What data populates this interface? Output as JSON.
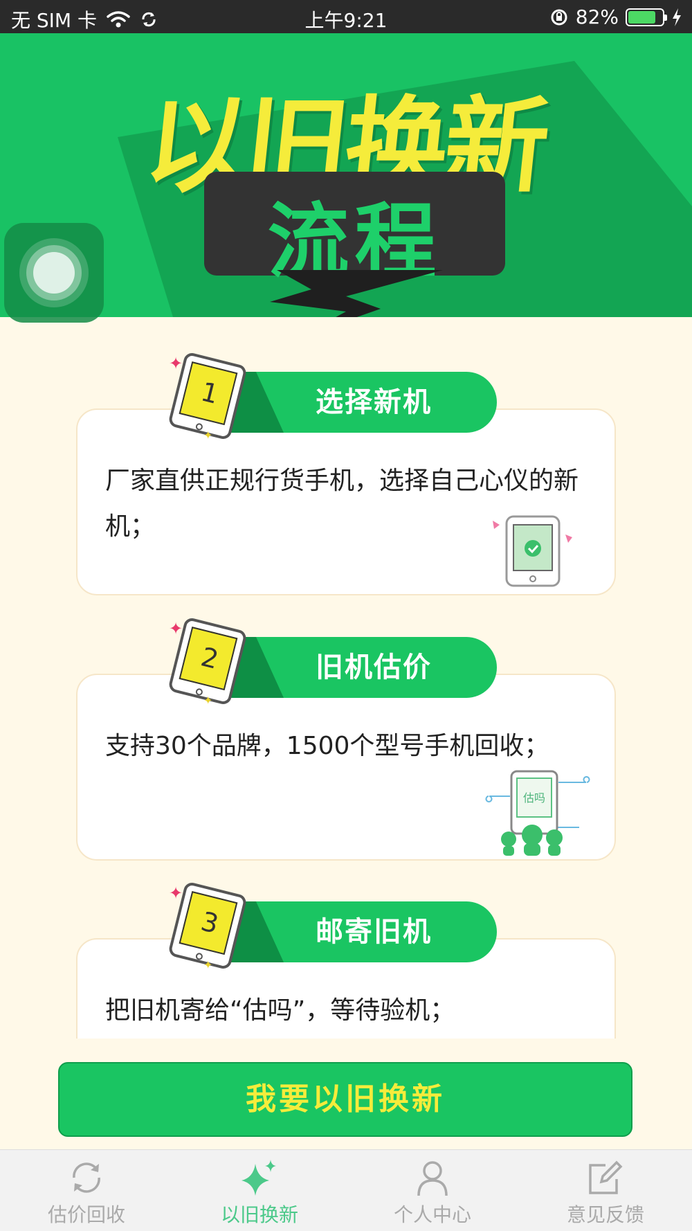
{
  "status_bar": {
    "carrier": "无 SIM 卡",
    "time": "上午9:21",
    "battery_percent": "82%",
    "battery_level": 0.82
  },
  "banner": {
    "title": "以旧换新",
    "subtitle": "流程"
  },
  "steps": [
    {
      "number": "1",
      "title": "选择新机",
      "description": "厂家直供正规行货手机，选择自己心仪的新机；"
    },
    {
      "number": "2",
      "title": "旧机估价",
      "description": "支持30个品牌，1500个型号手机回收；"
    },
    {
      "number": "3",
      "title": "邮寄旧机",
      "description": "把旧机寄给“估吗”，等待验机；"
    }
  ],
  "step2_illustration_text": "估吗",
  "cta": {
    "label": "我要以旧换新"
  },
  "tab_bar": {
    "items": [
      {
        "label": "估价回收",
        "icon": "refresh-icon",
        "active": false
      },
      {
        "label": "以旧换新",
        "icon": "sparkle-icon",
        "active": true
      },
      {
        "label": "个人中心",
        "icon": "person-icon",
        "active": false
      },
      {
        "label": "意见反馈",
        "icon": "edit-icon",
        "active": false
      }
    ]
  },
  "colors": {
    "brand_green": "#1ac562",
    "banner_yellow": "#f5ec3b",
    "page_bg": "#fff9e8",
    "active_tab": "#4cc98a"
  }
}
